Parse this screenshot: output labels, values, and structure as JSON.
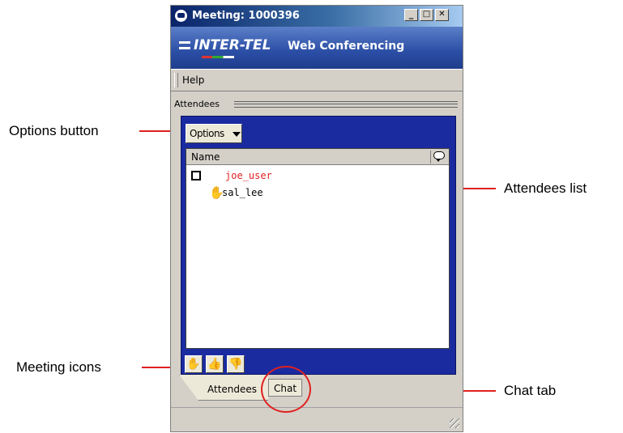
{
  "window": {
    "title": "Meeting: 1000396",
    "minimize": "_",
    "maximize": "□",
    "close": "✕"
  },
  "banner": {
    "logo": "INTER-TEL",
    "product": "Web Conferencing"
  },
  "menu": {
    "help": "Help"
  },
  "panel": {
    "label": "Attendees",
    "options_label": "Options",
    "column_name": "Name",
    "attendees": [
      {
        "name": "joe_user"
      },
      {
        "name": "sal_lee"
      }
    ]
  },
  "meeting_icons": [
    "raise-hand",
    "thumbs-up",
    "thumbs-down"
  ],
  "tabs": {
    "attendees": "Attendees",
    "chat": "Chat"
  },
  "callouts": {
    "options_button": "Options button",
    "attendees_list": "Attendees list",
    "meeting_icons": "Meeting icons",
    "chat_tab": "Chat tab"
  },
  "colors": {
    "callout_line": "#e02020",
    "panel_blue": "#1a2ba0",
    "host_name": "#e02020"
  }
}
